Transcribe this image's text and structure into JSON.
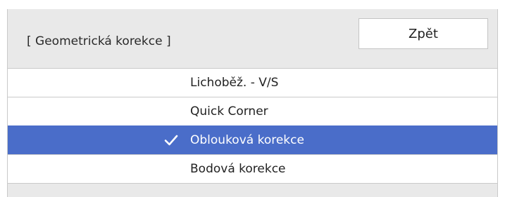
{
  "dialog": {
    "title": "[ Geometrická korekce ]",
    "back_label": "Zpět"
  },
  "menu": {
    "items": [
      {
        "label": "Lichoběž. - V/S",
        "selected": false
      },
      {
        "label": "Quick Corner",
        "selected": false
      },
      {
        "label": "Oblouková korekce",
        "selected": true
      },
      {
        "label": "Bodová korekce",
        "selected": false
      }
    ]
  },
  "colors": {
    "selected_background": "#4a6dc9",
    "panel_background": "#e9e9e9",
    "item_background": "#ffffff"
  },
  "icons": {
    "selected_marker": "check-icon"
  }
}
